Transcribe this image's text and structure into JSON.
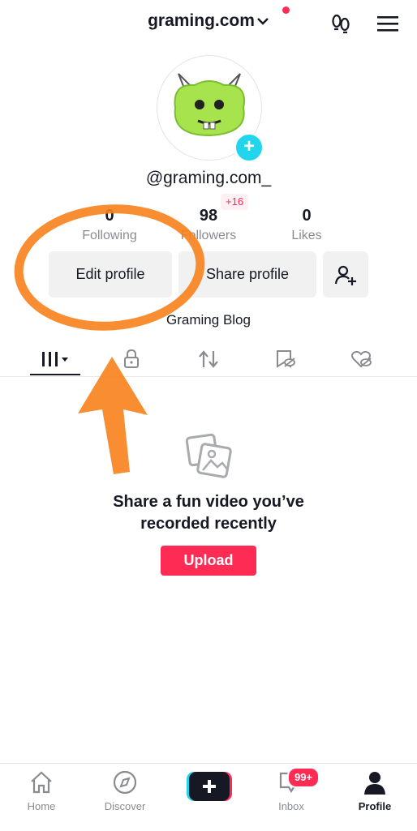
{
  "header": {
    "account_name": "graming.com"
  },
  "profile": {
    "handle": "@graming.com_",
    "bio": "Graming Blog"
  },
  "stats": [
    {
      "value": "0",
      "label": "Following"
    },
    {
      "value": "98",
      "label": "Followers"
    },
    {
      "value": "0",
      "label": "Likes"
    }
  ],
  "followers_new_badge": "+16",
  "actions": {
    "edit_profile": "Edit profile",
    "share_profile": "Share profile"
  },
  "empty_state": {
    "title_line1": "Share a fun video you’ve",
    "title_line2": "recorded recently",
    "upload_label": "Upload"
  },
  "bottom_nav": {
    "home": "Home",
    "discover": "Discover",
    "inbox": "Inbox",
    "inbox_badge": "99+",
    "profile": "Profile"
  },
  "colors": {
    "accent": "#fe2c55",
    "cyan": "#20d5ec",
    "annotation": "#f7821b",
    "avatar_green": "#a6e34d"
  }
}
